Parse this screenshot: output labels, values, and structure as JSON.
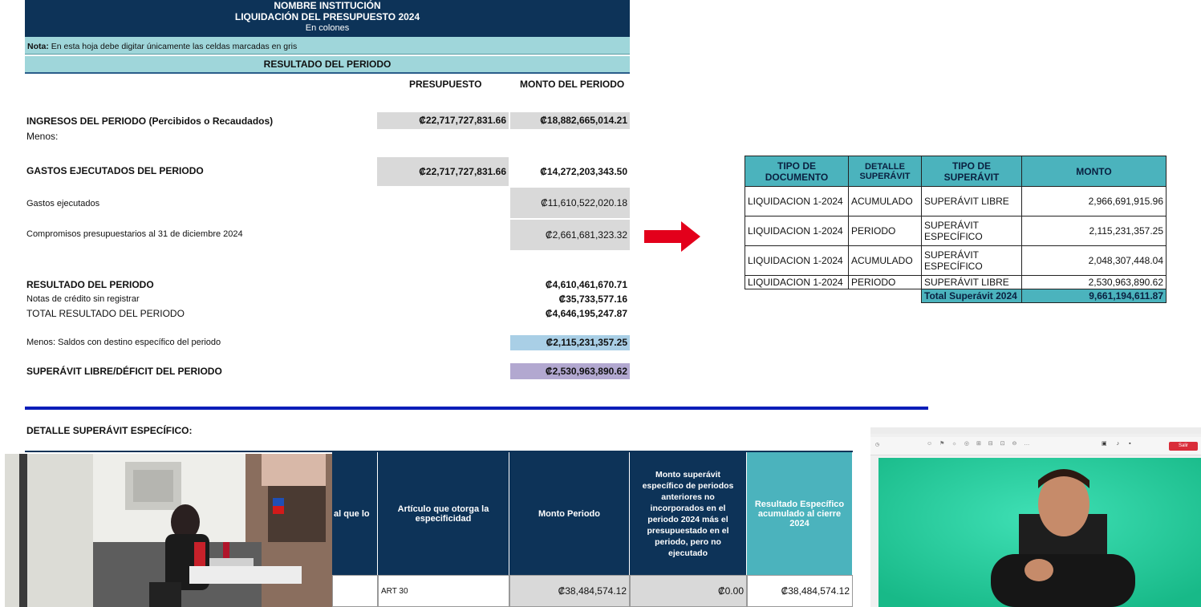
{
  "header": {
    "institution": "NOMBRE INSTITUCIÓN",
    "title": "LIQUIDACIÓN DEL PRESUPUESTO 2024",
    "currency": "En colones"
  },
  "note": {
    "prefix": "Nota:",
    "text": " En esta hoja debe digitar únicamente las celdas marcadas en gris"
  },
  "section_title": "RESULTADO DEL PERIODO",
  "columns": {
    "budget": "PRESUPUESTO",
    "period_amount": "MONTO DEL PERIODO"
  },
  "rows": {
    "income_label": "INGRESOS DEL PERIODO (Percibidos o Recaudados)",
    "income_budget": "₡22,717,727,831.66",
    "income_amount": "₡18,882,665,014.21",
    "less": "Menos:",
    "expenses_label": "GASTOS EJECUTADOS DEL PERIODO",
    "expenses_budget": "₡22,717,727,831.66",
    "expenses_amount": "₡14,272,203,343.50",
    "executed_label": "Gastos ejecutados",
    "executed_amount": "₡11,610,522,020.18",
    "commitments_label": "Compromisos presupuestarios al 31 de diciembre 2024",
    "commitments_amount": "₡2,661,681,323.32",
    "result_label": "RESULTADO DEL PERIODO",
    "result_amount": "₡4,610,461,670.71",
    "credit_notes_label": "Notas de crédito sin registrar",
    "credit_notes_amount": "₡35,733,577.16",
    "total_result_label": "TOTAL RESULTADO DEL PERIODO",
    "total_result_amount": "₡4,646,195,247.87",
    "specific_label": "Menos:  Saldos con destino específico del periodo",
    "specific_amount": "₡2,115,231,357.25",
    "surplus_label": "SUPERÁVIT LIBRE/DÉFICIT DEL PERIODO",
    "surplus_amount": "₡2,530,963,890.62"
  },
  "summary_table": {
    "headers": [
      "TIPO DE DOCUMENTO",
      "DETALLE SUPERÁVIT",
      "TIPO DE SUPERÁVIT",
      "MONTO"
    ],
    "rows": [
      [
        "LIQUIDACION 1-2024",
        "ACUMULADO",
        "SUPERÁVIT LIBRE",
        "2,966,691,915.96"
      ],
      [
        "LIQUIDACION 1-2024",
        "PERIODO",
        "SUPERÁVIT ESPECÍFICO",
        "2,115,231,357.25"
      ],
      [
        "LIQUIDACION 1-2024",
        "ACUMULADO",
        "SUPERÁVIT ESPECÍFICO",
        "2,048,307,448.04"
      ],
      [
        "LIQUIDACION 1-2024",
        "PERIODO",
        "SUPERÁVIT LIBRE",
        "2,530,963,890.62"
      ]
    ],
    "total_label": "Total Superávit 2024",
    "total_value": "9,661,194,611.87"
  },
  "detail": {
    "title": "DETALLE SUPERÁVIT ESPECÍFICO:",
    "headers": {
      "partial": "al que lo",
      "article": "Artículo que otorga la especificidad",
      "period_amount": "Monto Periodo",
      "prior_amount": "Monto superávit específico de periodos anteriores no incorporados en el periodo 2024 más el presupuestado en el periodo, pero no ejecutado",
      "result": "Resultado Específico acumulado al cierre 2024"
    },
    "row": {
      "article": "ART 30",
      "period_amount": "₡38,484,574.12",
      "prior_amount": "₡0.00",
      "result": "₡38,484,574.12"
    }
  },
  "video": {
    "leave_button": "Salir"
  },
  "colors": {
    "navy": "#0d3358",
    "teal": "#4bb3bd",
    "light_teal": "#9fd6da",
    "arrow": "#e3001b",
    "rule": "#0a1db8"
  }
}
